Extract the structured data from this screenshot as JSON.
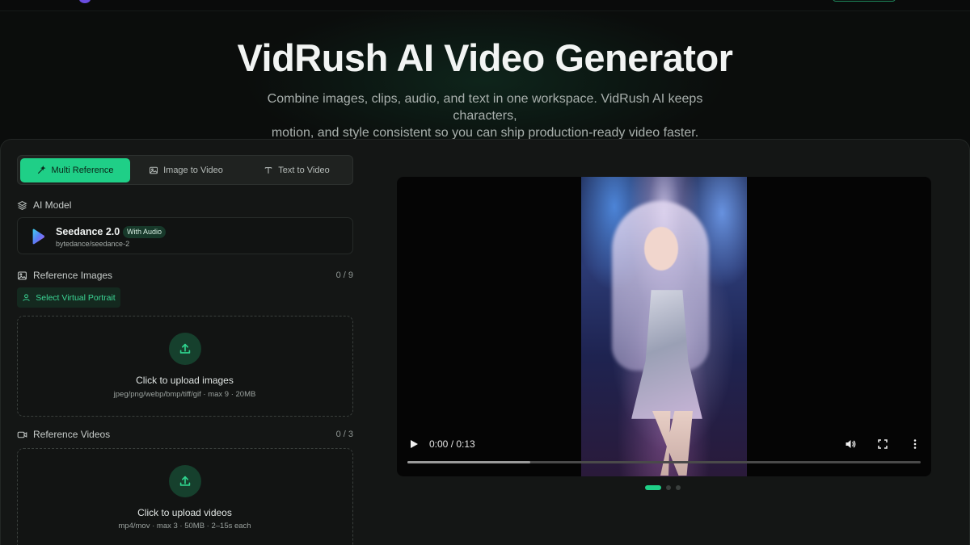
{
  "hero": {
    "title": "VidRush AI Video Generator",
    "subtitle_line1": "Combine images, clips, audio, and text in one workspace. VidRush AI keeps characters,",
    "subtitle_line2": "motion, and style consistent so you can ship production-ready video faster."
  },
  "tabs": [
    {
      "label": "Multi Reference",
      "icon": "wand-icon",
      "active": true
    },
    {
      "label": "Image to Video",
      "icon": "image-icon",
      "active": false
    },
    {
      "label": "Text to Video",
      "icon": "text-icon",
      "active": false
    }
  ],
  "model": {
    "section_label": "AI Model",
    "name": "Seedance 2.0",
    "badge": "With Audio",
    "id": "bytedance/seedance-2"
  },
  "reference_images": {
    "label": "Reference Images",
    "count": "0 / 9",
    "portrait_button": "Select Virtual Portrait",
    "upload_title": "Click to upload images",
    "upload_hint": "jpeg/png/webp/bmp/tiff/gif · max 9 · 20MB"
  },
  "reference_videos": {
    "label": "Reference Videos",
    "count": "0 / 3",
    "upload_title": "Click to upload videos",
    "upload_hint": "mp4/mov · max 3 · 50MB · 2–15s each"
  },
  "player": {
    "time": "0:00 / 0:13",
    "buffered_fraction": 0.24
  },
  "carousel": {
    "count": 3,
    "active_index": 0
  },
  "colors": {
    "accent": "#1fcf87",
    "background": "#0b0d0c",
    "panel": "#141615"
  }
}
